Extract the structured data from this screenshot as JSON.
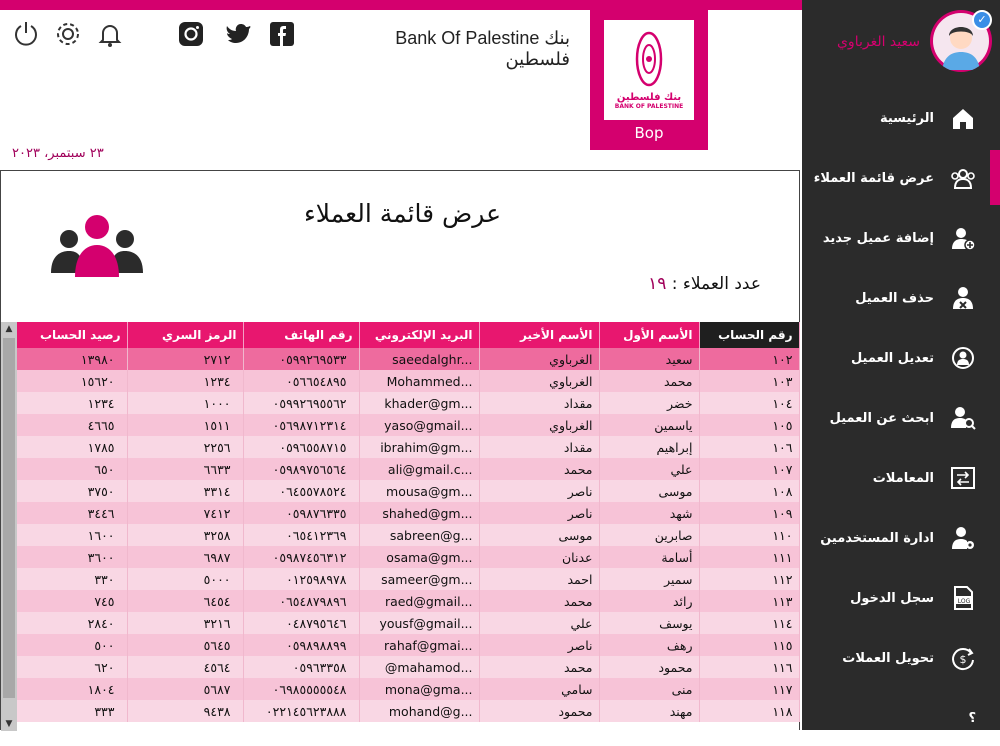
{
  "header": {
    "bank_title": "Bank Of Palestine بنك فلسطين",
    "logo_caption": "Bop",
    "logo_ar": "بنك فلسطين",
    "logo_en": "BANK OF PALESTINE",
    "date": "٢٣ سبتمبر، ٢٠٢٣"
  },
  "user": {
    "name": "سعيد الغرباوي"
  },
  "sidebar": {
    "items": [
      {
        "label": "الرئيسية",
        "icon": "home-icon"
      },
      {
        "label": "عرض قائمة العملاء",
        "icon": "users-icon"
      },
      {
        "label": "إضافة عميل جديد",
        "icon": "add-user-icon"
      },
      {
        "label": "حذف العميل",
        "icon": "delete-user-icon"
      },
      {
        "label": "تعديل العميل",
        "icon": "edit-user-icon"
      },
      {
        "label": "ابحث عن العميل",
        "icon": "search-user-icon"
      },
      {
        "label": "المعاملات",
        "icon": "transactions-icon"
      },
      {
        "label": "ادارة المستخدمين",
        "icon": "user-settings-icon"
      },
      {
        "label": "سجل الدخول",
        "icon": "log-icon"
      },
      {
        "label": "تحويل العملات",
        "icon": "currency-icon"
      },
      {
        "label": "؟",
        "icon": "help-icon"
      }
    ]
  },
  "page": {
    "title": "عرض قائمة العملاء",
    "count_label": "عدد العملاء :",
    "count_value": "١٩"
  },
  "table": {
    "headers": [
      "رقم الحساب",
      "الأسم الأول",
      "الأسم الأخير",
      "البريد الإلكتروني",
      "رقم الهاتف",
      "الرمز السري",
      "رصيد الحساب"
    ],
    "rows": [
      [
        "١٠٢",
        "سعيد",
        "الغرباوي",
        "saeedalghr...",
        "٠٥٩٩٢٦٩٥٣٣",
        "٢٧١٢",
        "١٣٩٨٠"
      ],
      [
        "١٠٣",
        "محمد",
        "الغرباوي",
        "Mohammed...",
        "٠٥٦٦٥٤٨٩٥",
        "١٢٣٤",
        "١٥٦٢٠"
      ],
      [
        "١٠٤",
        "خضر",
        "مقداد",
        "khader@gm...",
        "٠٥٩٩٢٦٩٥٥٦٢",
        "١٠٠٠",
        "١٢٣٤"
      ],
      [
        "١٠٥",
        "ياسمين",
        "الغرباوي",
        "yaso@gmail...",
        "٠٥٦٩٨٧١٢٣١٤",
        "١٥١١",
        "٤٦٦٥"
      ],
      [
        "١٠٦",
        "إبراهيم",
        "مقداد",
        "ibrahim@gm...",
        "٠٥٩٦٥٥٨٧١٥",
        "٢٢٥٦",
        "١٧٨٥"
      ],
      [
        "١٠٧",
        "علي",
        "محمد",
        "ali@gmail.c...",
        "٠٥٩٨٩٧٥٦٥٦٤",
        "٦٦٣٣",
        "٦٥٠"
      ],
      [
        "١٠٨",
        "موسى",
        "ناصر",
        "mousa@gm...",
        "٠٦٤٥٥٧٨٥٢٤",
        "٣٣١٤",
        "٣٧٥٠"
      ],
      [
        "١٠٩",
        "شهد",
        "ناصر",
        "shahed@gm...",
        "٠٥٩٨٧٦٣٣٥",
        "٧٤١٢",
        "٣٤٤٦"
      ],
      [
        "١١٠",
        "صابرين",
        "موسى",
        "sabreen@g...",
        "٠٦٥٤١٢٣٦٩",
        "٣٢٥٨",
        "١٦٠٠"
      ],
      [
        "١١١",
        "أسامة",
        "عدنان",
        "osama@gm...",
        "٠٥٩٨٧٤٥٦٣١٢",
        "٦٩٨٧",
        "٣٦٠٠"
      ],
      [
        "١١٢",
        "سمير",
        "احمد",
        "sameer@gm...",
        "٠١٢٥٩٨٩٧٨",
        "٥٠٠٠",
        "٣٣٠"
      ],
      [
        "١١٣",
        "رائد",
        "محمد",
        "raed@gmail...",
        "٠٦٥٤٨٧٩٨٩٦",
        "٦٤٥٤",
        "٧٤٥"
      ],
      [
        "١١٤",
        "يوسف",
        "علي",
        "yousf@gmail...",
        "٠٤٨٧٩٥٦٤٦",
        "٣٢١٦",
        "٢٨٤٠"
      ],
      [
        "١١٥",
        "رهف",
        "ناصر",
        "rahaf@gmai...",
        "٠٥٩٨٩٨٨٩٩",
        "٥٦٤٥",
        "٥٠٠"
      ],
      [
        "١١٦",
        "محمود",
        "محمد",
        "@mahamod...",
        "٠٥٩٦٣٣٥٨",
        "٤٥٦٤",
        "٦٢٠"
      ],
      [
        "١١٧",
        "منى",
        "سامي",
        "mona@gma...",
        "٠٦٩٨٥٥٥٥٥٤٨",
        "٥٦٨٧",
        "١٨٠٤"
      ],
      [
        "١١٨",
        "مهند",
        "محمود",
        "mohand@g...",
        "٠٢٢١٤٥٦٢٣٨٨٨",
        "٩٤٣٨",
        "٣٣٣"
      ]
    ]
  },
  "colors": {
    "accent": "#d4006e",
    "sidebar": "#2b2b2b",
    "header_row": "#e8176f"
  }
}
